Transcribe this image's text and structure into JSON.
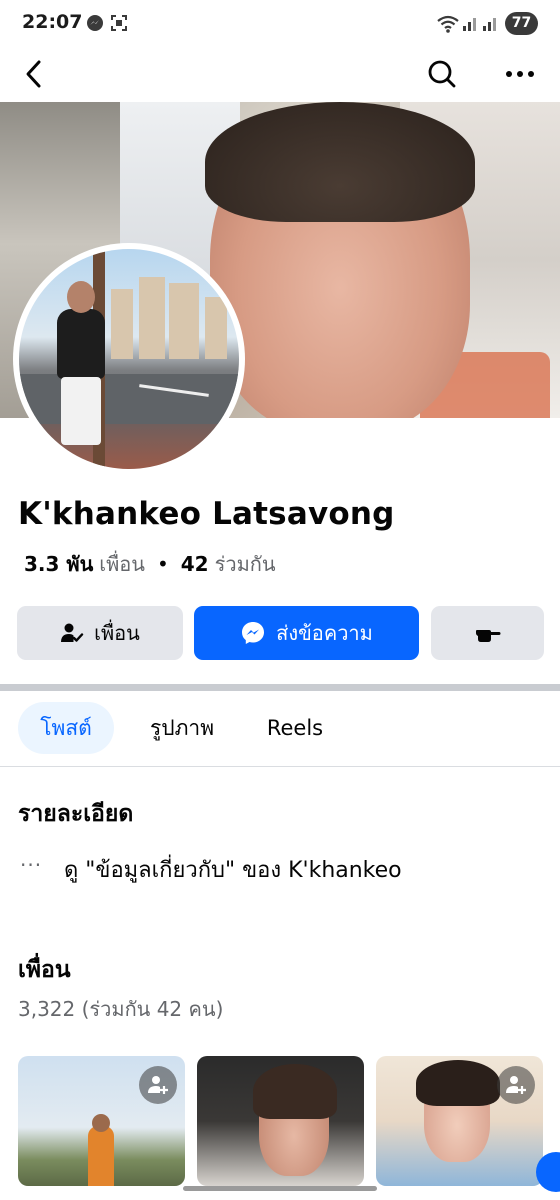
{
  "status_bar": {
    "time": "22:07",
    "battery": "77"
  },
  "header": {
    "back_icon": "chevron-left-icon",
    "search_icon": "search-icon",
    "more_icon": "more-horizontal-icon"
  },
  "profile": {
    "name": "K'khankeo Latsavong",
    "friends_count": "3.3 พัน",
    "friends_label": "เพื่อน",
    "mutual_count": "42",
    "mutual_label": "ร่วมกัน"
  },
  "actions": {
    "friends_label": "เพื่อน",
    "message_label": "ส่งข้อความ"
  },
  "tabs": [
    {
      "label": "โพสต์",
      "active": true
    },
    {
      "label": "รูปภาพ",
      "active": false
    },
    {
      "label": "Reels",
      "active": false
    }
  ],
  "details": {
    "title": "รายละเอียด",
    "more_glyph": "···",
    "about_text": "ดู \"ข้อมูลเกี่ยวกับ\" ของ K'khankeo"
  },
  "friends_section": {
    "title": "เพื่อน",
    "summary": "3,322 (ร่วมกัน 42 คน)"
  },
  "colors": {
    "accent": "#0866ff",
    "button_gray": "#e4e6eb",
    "secondary_text": "#65676b",
    "active_tab_bg": "#ebf5ff"
  }
}
